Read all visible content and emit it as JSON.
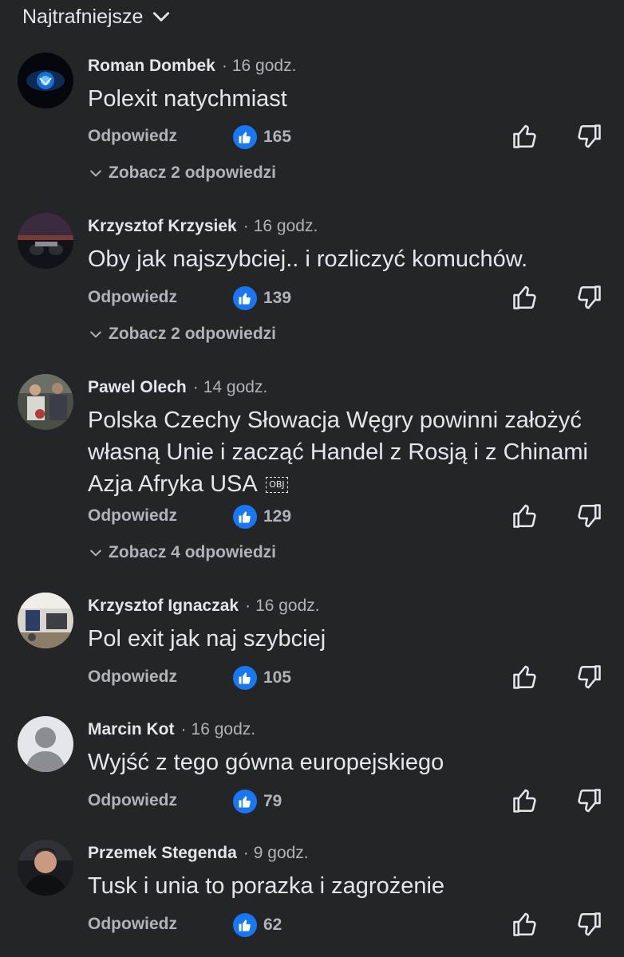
{
  "sort": {
    "label": "Najtrafniejsze"
  },
  "labels": {
    "reply": "Odpowiedz"
  },
  "colors": {
    "background": "#242526",
    "like_blue": "#1877f2",
    "secondary_text": "#b0b3b8"
  },
  "comments": [
    {
      "author": "Roman Dombek",
      "time": "16 godz.",
      "text": "Polexit natychmiast",
      "likes": "165",
      "replies_label": "Zobacz 2 odpowiedzi"
    },
    {
      "author": "Krzysztof Krzysiek",
      "time": "16 godz.",
      "text": "Oby jak najszybciej.. i rozliczyć komuchów.",
      "likes": "139",
      "replies_label": "Zobacz 2 odpowiedzi"
    },
    {
      "author": "Pawel Olech",
      "time": "14 godz.",
      "text": "Polska Czechy Słowacja Węgry powinni założyć własną Unie i zacząć Handel z Rosją i z Chinami Azja Afryka USA",
      "obj": "OBJ",
      "likes": "129",
      "replies_label": "Zobacz 4 odpowiedzi"
    },
    {
      "author": "Krzysztof Ignaczak",
      "time": "16 godz.",
      "text": "Pol exit jak naj szybciej",
      "likes": "105"
    },
    {
      "author": "Marcin Kot",
      "time": "16 godz.",
      "text": "Wyjść z tego gówna europejskiego",
      "likes": "79"
    },
    {
      "author": "Przemek Stegenda",
      "time": "9 godz.",
      "text": "Tusk i unia to porazka i zagrożenie",
      "likes": "62"
    }
  ]
}
